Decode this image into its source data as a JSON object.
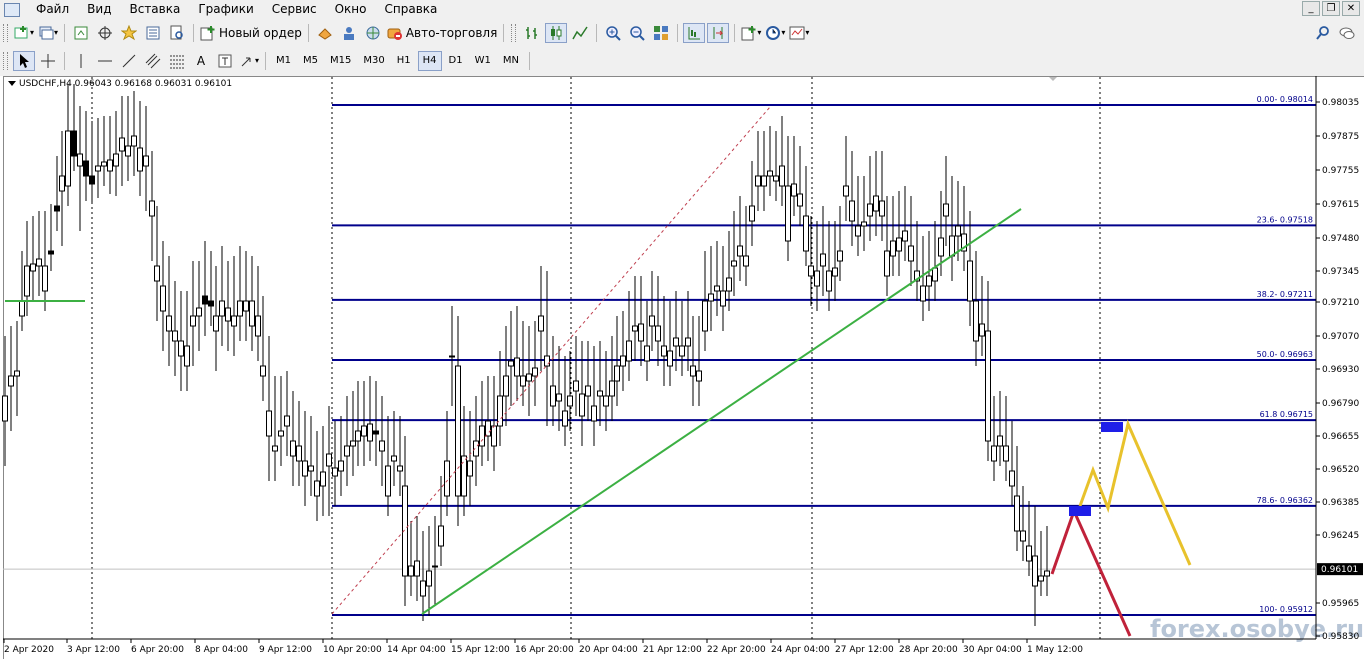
{
  "menu": [
    "Файл",
    "Вид",
    "Вставка",
    "Графики",
    "Сервис",
    "Окно",
    "Справка"
  ],
  "toolbar": {
    "new_order_label": "Новый ордер",
    "autotrading_label": "Авто-торговля"
  },
  "timeframes": [
    "M1",
    "M5",
    "M15",
    "M30",
    "H1",
    "H4",
    "D1",
    "W1",
    "MN"
  ],
  "active_timeframe": "H4",
  "chart": {
    "symbol_line": "USDCHF,H4  0.96043 0.96168 0.96031 0.96101",
    "current_price": "0.96101",
    "price_ticks": [
      "0.98035",
      "0.97875",
      "0.97755",
      "0.97615",
      "0.97480",
      "0.97345",
      "0.97210",
      "0.97070",
      "0.96930",
      "0.96790",
      "0.96655",
      "0.96520",
      "0.96385",
      "0.96245",
      "0.95965",
      "0.95830"
    ],
    "time_labels": [
      "2 Apr 2020",
      "3 Apr 12:00",
      "6 Apr 20:00",
      "8 Apr 04:00",
      "9 Apr 12:00",
      "10 Apr 20:00",
      "14 Apr 04:00",
      "15 Apr 12:00",
      "16 Apr 20:00",
      "20 Apr 04:00",
      "21 Apr 12:00",
      "22 Apr 20:00",
      "24 Apr 04:00",
      "27 Apr 12:00",
      "28 Apr 20:00",
      "30 Apr 04:00",
      "1 May 12:00"
    ],
    "fib_levels": [
      {
        "label": "0.00- 0.98014",
        "price": 0.98014
      },
      {
        "label": "23.6- 0.97518",
        "price": 0.97518
      },
      {
        "label": "38.2- 0.97211",
        "price": 0.97211
      },
      {
        "label": "50.0- 0.96963",
        "price": 0.96963
      },
      {
        "label": "61.8 0.96715",
        "price": 0.96715
      },
      {
        "label": "78.6- 0.96362",
        "price": 0.96362
      },
      {
        "label": "100- 0.95912",
        "price": 0.95912
      }
    ],
    "watermark": "forex.osobye.ru",
    "colors": {
      "fib": "#00008b",
      "trend": "#3cb043",
      "bear_path": "#c0223a",
      "bull_path": "#e8c22c",
      "zone": "#1e1ee8",
      "candle_bear": "#000000",
      "candle_bull": "#ffffff"
    }
  }
}
